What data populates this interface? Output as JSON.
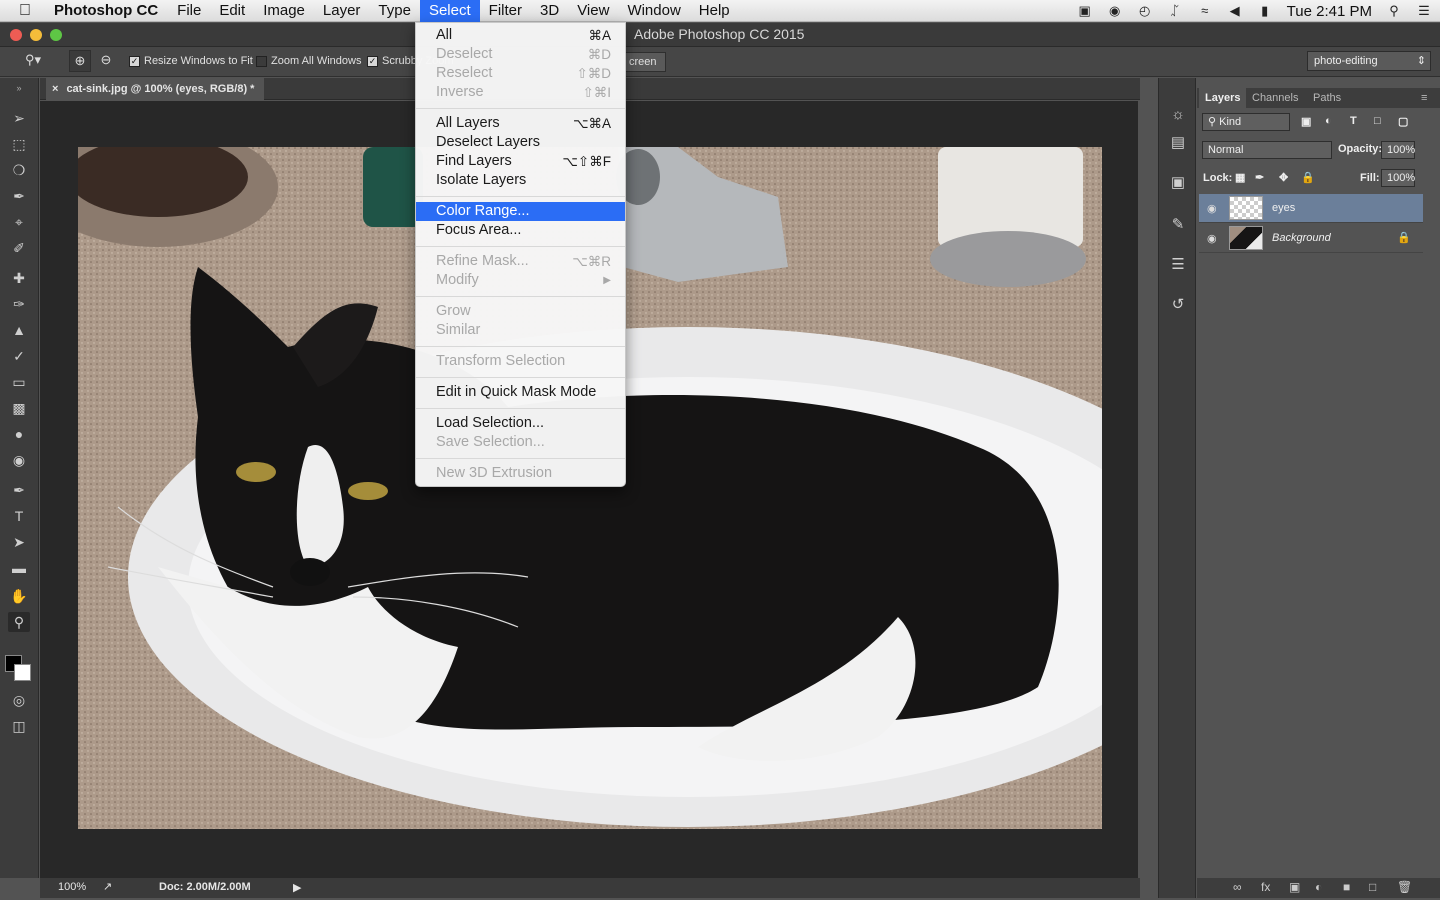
{
  "menubar": {
    "app": "Photoshop CC",
    "items": [
      "File",
      "Edit",
      "Image",
      "Layer",
      "Type",
      "Select",
      "Filter",
      "3D",
      "View",
      "Window",
      "Help"
    ],
    "active": "Select",
    "clock": "Tue 2:41 PM"
  },
  "window": {
    "title": "Adobe Photoshop CC 2015"
  },
  "options": {
    "resize_windows": "Resize Windows to Fit",
    "zoom_all": "Zoom All Windows",
    "scrubby": "Scrubby Zoom",
    "fit_screen_tail": "creen",
    "workspace": "photo-editing"
  },
  "document": {
    "tab": "cat-sink.jpg @ 100% (eyes, RGB/8) *",
    "zoom": "100%",
    "doc_size": "Doc: 2.00M/2.00M"
  },
  "layers_panel": {
    "tabs": [
      "Layers",
      "Channels",
      "Paths"
    ],
    "kind": "Kind",
    "blend_mode": "Normal",
    "opacity_label": "Opacity:",
    "opacity": "100%",
    "lock_label": "Lock:",
    "fill_label": "Fill:",
    "fill": "100%",
    "layers": [
      {
        "name": "eyes",
        "selected": true
      },
      {
        "name": "Background",
        "locked": true
      }
    ]
  },
  "select_menu": {
    "items": [
      {
        "label": "All",
        "shortcut": "⌘A",
        "enabled": true
      },
      {
        "label": "Deselect",
        "shortcut": "⌘D",
        "enabled": false
      },
      {
        "label": "Reselect",
        "shortcut": "⇧⌘D",
        "enabled": false
      },
      {
        "label": "Inverse",
        "shortcut": "⇧⌘I",
        "enabled": false
      },
      {
        "label": "All Layers",
        "shortcut": "⌥⌘A",
        "enabled": true
      },
      {
        "label": "Deselect Layers",
        "shortcut": "",
        "enabled": true
      },
      {
        "label": "Find Layers",
        "shortcut": "⌥⇧⌘F",
        "enabled": true
      },
      {
        "label": "Isolate Layers",
        "shortcut": "",
        "enabled": true
      },
      {
        "label": "Color Range...",
        "shortcut": "",
        "enabled": true,
        "highlighted": true
      },
      {
        "label": "Focus Area...",
        "shortcut": "",
        "enabled": true
      },
      {
        "label": "Refine Mask...",
        "shortcut": "⌥⌘R",
        "enabled": false
      },
      {
        "label": "Modify",
        "shortcut": "▶",
        "enabled": false
      },
      {
        "label": "Grow",
        "shortcut": "",
        "enabled": false
      },
      {
        "label": "Similar",
        "shortcut": "",
        "enabled": false
      },
      {
        "label": "Transform Selection",
        "shortcut": "",
        "enabled": false
      },
      {
        "label": "Edit in Quick Mask Mode",
        "shortcut": "",
        "enabled": true
      },
      {
        "label": "Load Selection...",
        "shortcut": "",
        "enabled": true
      },
      {
        "label": "Save Selection...",
        "shortcut": "",
        "enabled": false
      },
      {
        "label": "New 3D Extrusion",
        "shortcut": "",
        "enabled": false
      }
    ]
  },
  "colors": {
    "accent": "#2b6df5",
    "selected_layer": "#6b7f9a"
  }
}
